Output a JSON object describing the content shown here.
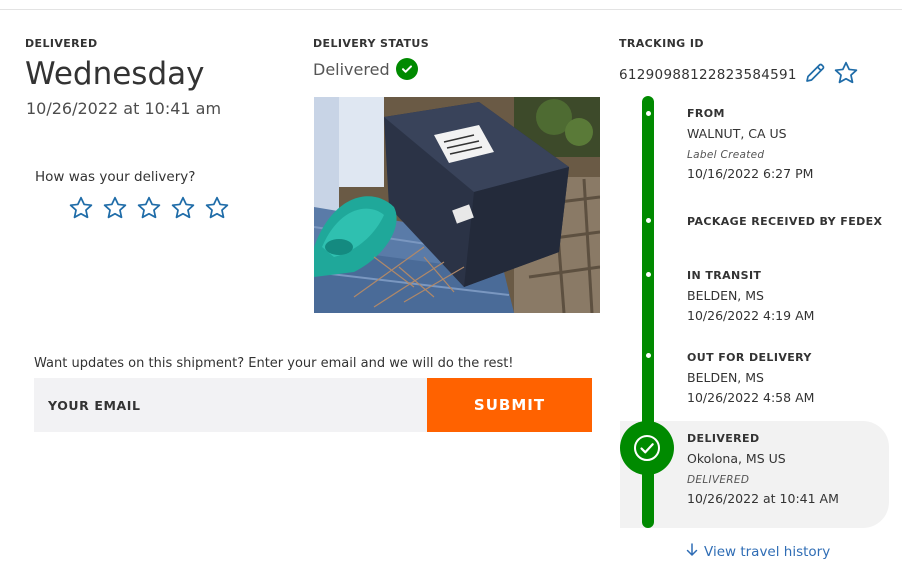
{
  "delivery": {
    "label": "DELIVERED",
    "day": "Wednesday",
    "datetime": "10/26/2022 at 10:41 am"
  },
  "rating": {
    "question": "How was your delivery?",
    "stars": 5,
    "star_color": "#1f6ca8"
  },
  "status": {
    "label": "DELIVERY STATUS",
    "value": "Delivered"
  },
  "tracking": {
    "label": "TRACKING ID",
    "number": "612909881228235845​91",
    "edit_icon": "pencil-icon",
    "favorite_icon": "star-icon"
  },
  "updates": {
    "prompt": "Want updates on this shipment? Enter your email and we will do the rest!",
    "email_placeholder": "YOUR EMAIL",
    "submit_label": "SUBMIT"
  },
  "timeline": {
    "events": [
      {
        "title": "FROM",
        "location": "WALNUT, CA US",
        "note": "Label Created",
        "datetime": "10/16/2022 6:27 PM"
      },
      {
        "title": "PACKAGE RECEIVED BY FEDEX",
        "location": "",
        "note": "",
        "datetime": ""
      },
      {
        "title": "IN TRANSIT",
        "location": "BELDEN, MS",
        "note": "",
        "datetime": "10/26/2022 4:19 AM"
      },
      {
        "title": "OUT FOR DELIVERY",
        "location": "BELDEN, MS",
        "note": "",
        "datetime": "10/26/2022 4:58 AM"
      },
      {
        "title": "DELIVERED",
        "location": "Okolona, MS US",
        "note": "DELIVERED",
        "datetime": "10/26/2022 at 10:41 AM"
      }
    ],
    "history_link": "View travel history"
  },
  "colors": {
    "accent_orange": "#ff6200",
    "success_green": "#008a00",
    "link_blue": "#2f6db5"
  }
}
